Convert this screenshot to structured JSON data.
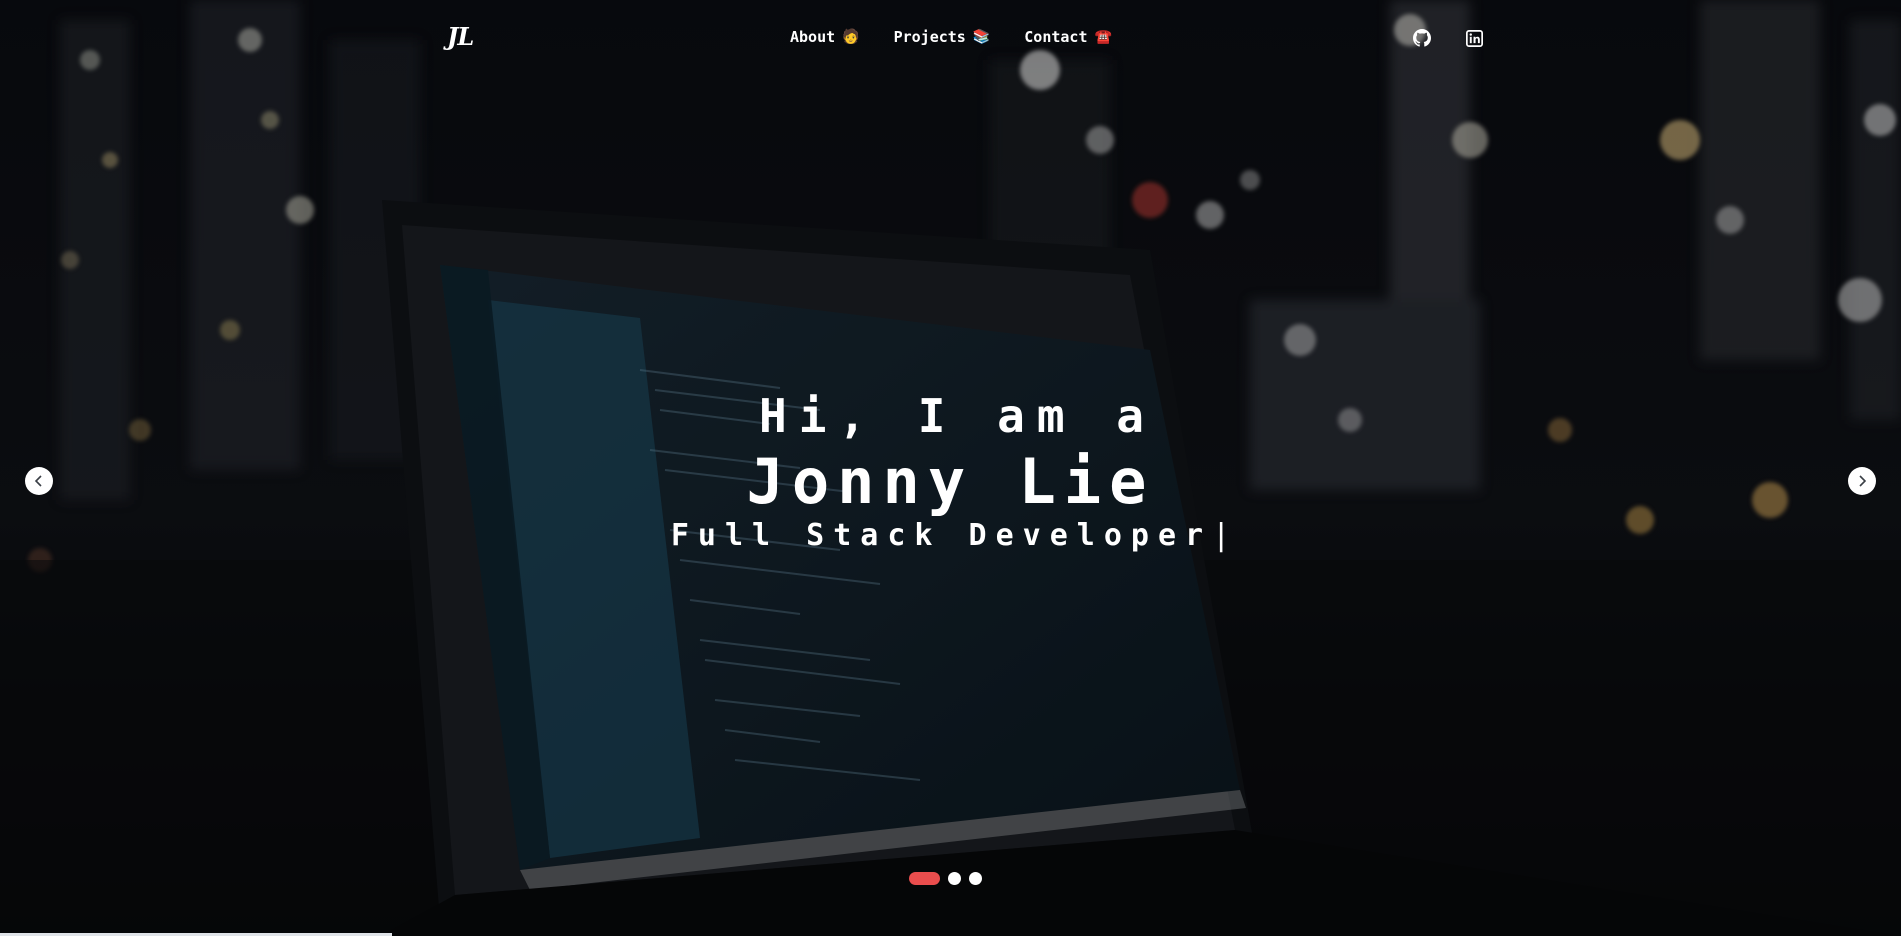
{
  "nav": {
    "brand": "JL",
    "links": [
      {
        "label": "About",
        "emoji": "🧑"
      },
      {
        "label": "Projects",
        "emoji": "📚"
      },
      {
        "label": "Contact",
        "emoji": "☎️"
      }
    ],
    "social": [
      {
        "icon": "github-icon"
      },
      {
        "icon": "linkedin-icon"
      }
    ]
  },
  "hero": {
    "greeting": "Hi, I am a",
    "name": "Jonny Lie",
    "role": "Full Stack Developer",
    "cursor": "|"
  },
  "carousel": {
    "slides": 3,
    "active_slide": 0,
    "colors": {
      "active_indicator": "#ea4d4d",
      "indicator": "#ffffff"
    }
  }
}
